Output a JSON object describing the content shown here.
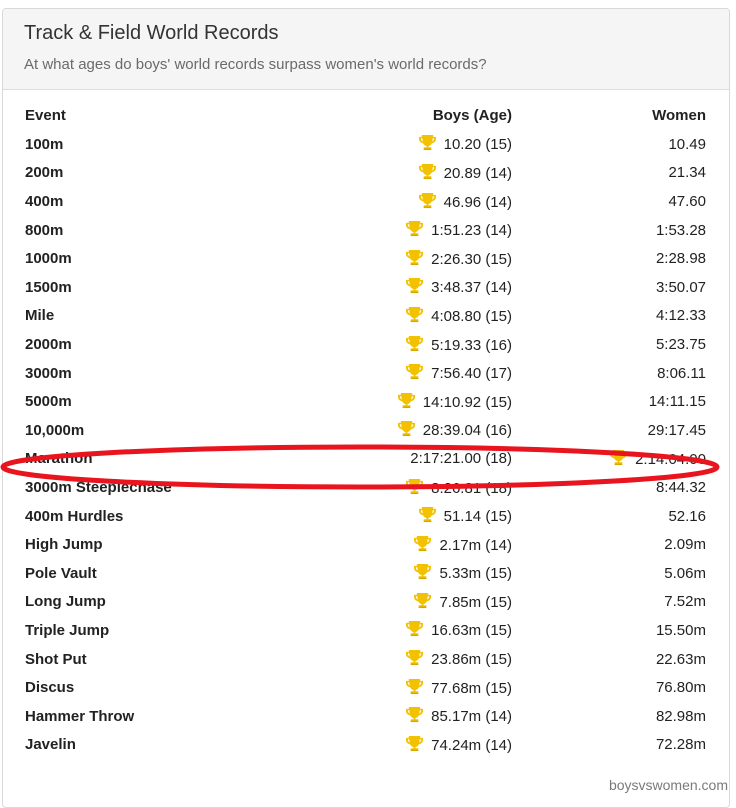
{
  "header": {
    "title": "Track & Field World Records",
    "subtitle": "At what ages do boys' world records surpass women's world records?"
  },
  "table": {
    "columns": [
      "Event",
      "Boys (Age)",
      "Women"
    ],
    "rows": [
      {
        "event": "100m",
        "boys": "10.20 (15)",
        "women": "10.49",
        "winner": "boys"
      },
      {
        "event": "200m",
        "boys": "20.89 (14)",
        "women": "21.34",
        "winner": "boys"
      },
      {
        "event": "400m",
        "boys": "46.96 (14)",
        "women": "47.60",
        "winner": "boys"
      },
      {
        "event": "800m",
        "boys": "1:51.23 (14)",
        "women": "1:53.28",
        "winner": "boys"
      },
      {
        "event": "1000m",
        "boys": "2:26.30 (15)",
        "women": "2:28.98",
        "winner": "boys"
      },
      {
        "event": "1500m",
        "boys": "3:48.37 (14)",
        "women": "3:50.07",
        "winner": "boys"
      },
      {
        "event": "Mile",
        "boys": "4:08.80 (15)",
        "women": "4:12.33",
        "winner": "boys"
      },
      {
        "event": "2000m",
        "boys": "5:19.33 (16)",
        "women": "5:23.75",
        "winner": "boys"
      },
      {
        "event": "3000m",
        "boys": "7:56.40 (17)",
        "women": "8:06.11",
        "winner": "boys"
      },
      {
        "event": "5000m",
        "boys": "14:10.92 (15)",
        "women": "14:11.15",
        "winner": "boys"
      },
      {
        "event": "10,000m",
        "boys": "28:39.04 (16)",
        "women": "29:17.45",
        "winner": "boys"
      },
      {
        "event": "Marathon",
        "boys": "2:17:21.00 (18)",
        "women": "2:14:04.00",
        "winner": "women"
      },
      {
        "event": "3000m Steeplechase",
        "boys": "8:26.81 (18)",
        "women": "8:44.32",
        "winner": "boys"
      },
      {
        "event": "400m Hurdles",
        "boys": "51.14 (15)",
        "women": "52.16",
        "winner": "boys"
      },
      {
        "event": "High Jump",
        "boys": "2.17m (14)",
        "women": "2.09m",
        "winner": "boys"
      },
      {
        "event": "Pole Vault",
        "boys": "5.33m (15)",
        "women": "5.06m",
        "winner": "boys"
      },
      {
        "event": "Long Jump",
        "boys": "7.85m (15)",
        "women": "7.52m",
        "winner": "boys"
      },
      {
        "event": "Triple Jump",
        "boys": "16.63m (15)",
        "women": "15.50m",
        "winner": "boys"
      },
      {
        "event": "Shot Put",
        "boys": "23.86m (15)",
        "women": "22.63m",
        "winner": "boys"
      },
      {
        "event": "Discus",
        "boys": "77.68m (15)",
        "women": "76.80m",
        "winner": "boys"
      },
      {
        "event": "Hammer Throw",
        "boys": "85.17m (14)",
        "women": "82.98m",
        "winner": "boys"
      },
      {
        "event": "Javelin",
        "boys": "74.24m (14)",
        "women": "72.28m",
        "winner": "boys"
      }
    ]
  },
  "highlight": {
    "event": "Marathon",
    "color": "#e8141e"
  },
  "colors": {
    "trophy": "#f2c200",
    "trophy_dark": "#d9a800"
  },
  "footer": {
    "link": "boysvswomen.com"
  }
}
